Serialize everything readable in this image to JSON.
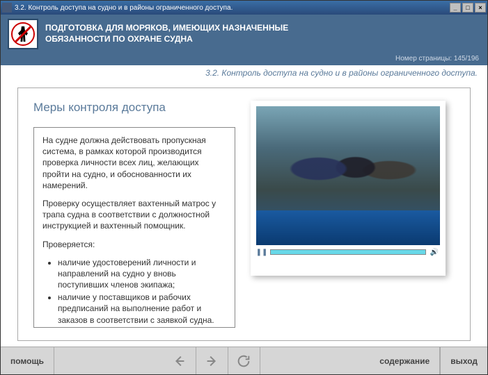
{
  "window": {
    "title": "3.2. Контроль доступа на судно и в районы ограниченного доступа."
  },
  "header": {
    "line1": "ПОДГОТОВКА ДЛЯ МОРЯКОВ, ИМЕЮЩИХ НАЗНАЧЕННЫЕ",
    "line2": "ОБЯЗАННОСТИ ПО ОХРАНЕ СУДНА",
    "page_label": "Номер страницы: 145/196"
  },
  "breadcrumb": "3.2. Контроль доступа на судно и в районы ограниченного доступа.",
  "section": {
    "title": "Меры контроля доступа",
    "para1": "На судне должна действовать пропускная система, в рамках которой производится проверка личности всех лиц, желающих пройти на судно, и обоснованности их намерений.",
    "para2": "Проверку осуществляет вахтенный матрос у трапа судна в соответствии с должностной инструкцией и вахтенный помощник.",
    "para3": "Проверяется:",
    "bullet1": "наличие удостоверений личности и направлений на судно у вновь поступивших членов экипажа;",
    "bullet2": "наличие у поставщиков и рабочих предписаний на выполнение работ и заказов в соответствии с заявкой судна. Контролируется количество людей, занятых в грузовых операциях, и их личности согласно списку, а"
  },
  "footer": {
    "help": "помощь",
    "contents": "содержание",
    "exit": "выход"
  }
}
